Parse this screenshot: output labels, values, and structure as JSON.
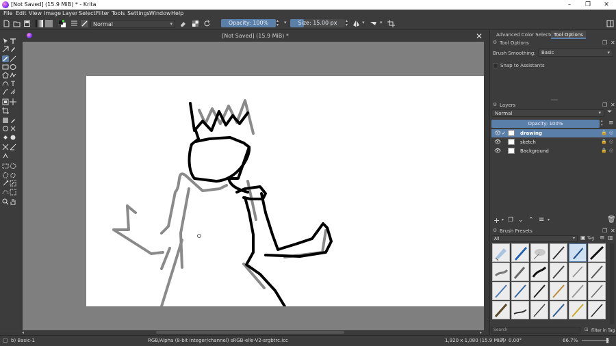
{
  "window": {
    "title": "[Not Saved]  (15.9 MiB) * - Krita",
    "controls": [
      "–",
      "❐",
      "✕"
    ]
  },
  "menu": [
    "File",
    "Edit",
    "View",
    "Image",
    "Layer",
    "Select",
    "Filter",
    "Tools",
    "Settings",
    "Window",
    "Help"
  ],
  "toolbar": {
    "blend_mode": "Normal",
    "opacity_label": "Opacity: 100%",
    "opacity_value": 1.0,
    "size_label": "Size: 15.00 px",
    "size_value": 15.0
  },
  "document": {
    "tab_title": "[Not Saved]  (15.9 MiB) *"
  },
  "dockers": {
    "tabs": [
      "Advanced Color Selector",
      "Tool Options"
    ],
    "active_tab": "Tool Options",
    "tool_options": {
      "header": "Tool Options",
      "brush_smoothing_label": "Brush Smoothing:",
      "brush_smoothing_value": "Basic",
      "snap_label": "Snap to Assistants"
    },
    "layers": {
      "header": "Layers",
      "blend_mode": "Normal",
      "opacity_label": "Opacity:  100%",
      "items": [
        {
          "name": "drawing",
          "selected": true
        },
        {
          "name": "sketch",
          "selected": false
        },
        {
          "name": "Background",
          "selected": false
        }
      ]
    },
    "brush_presets": {
      "header": "Brush Presets",
      "filter": "All",
      "tag_label": "Tag",
      "search_placeholder": "Search",
      "filter_in_tag": "Filter in Tag"
    }
  },
  "status": {
    "brush": "b) Basic-1",
    "color_model": "RGB/Alpha (8-bit integer/channel)  sRGB-elle-V2-srgbtrc.icc",
    "image_size": "1,920 x 1,080 (15.9 MiB)",
    "rotation": "0.00°",
    "zoom": "66.7%"
  },
  "colors": {
    "accent": "#5a7fa8",
    "panel": "#3c3c3c",
    "canvas_bg": "#7f7f7f",
    "sketch_stroke": "#8a8a8a",
    "ink_stroke": "#000000"
  }
}
